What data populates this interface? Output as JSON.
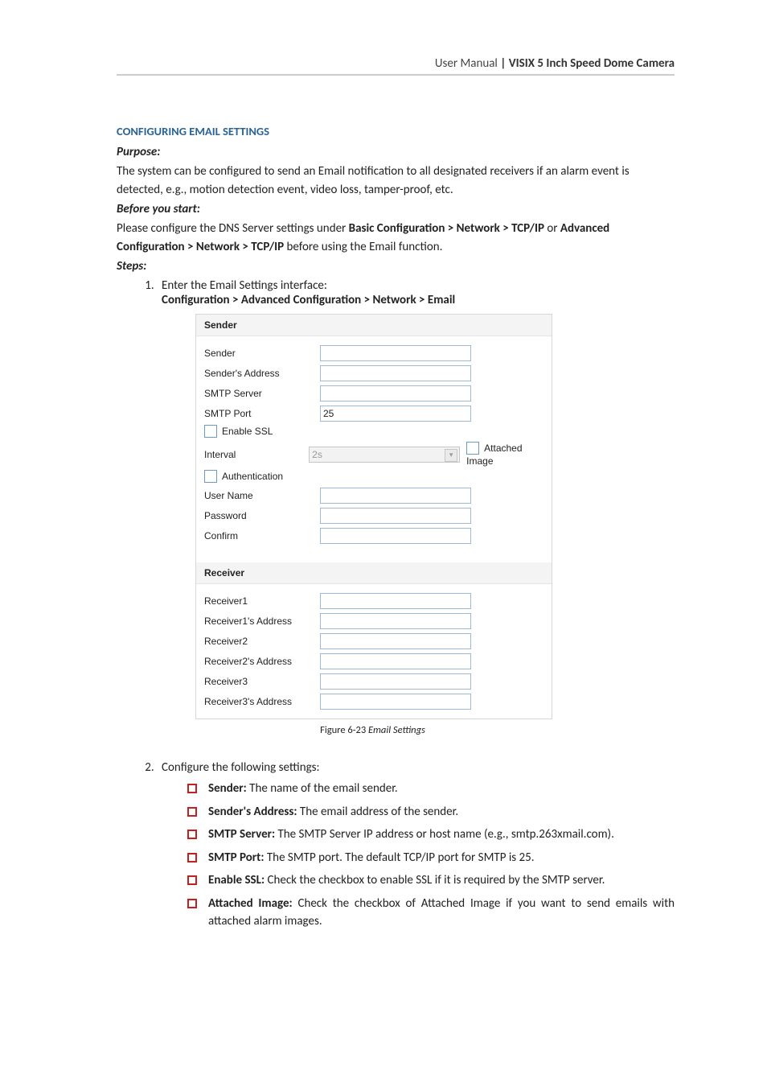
{
  "header": {
    "left": "User Manual",
    "right": " | VISIX 5 Inch Speed Dome Camera"
  },
  "section_title": "CONFIGURING EMAIL SETTINGS",
  "purpose_label": "Purpose:",
  "purpose_text": "The system can be configured to send an Email notification to all designated receivers if an alarm event is detected, e.g., motion detection event, video loss, tamper-proof, etc.",
  "before_label": "Before you start:",
  "before_text_a": "Please configure the DNS Server settings under ",
  "before_text_b": "Basic Configuration > Network > TCP/IP",
  "before_text_c": " or ",
  "before_text_d": "Advanced Configuration > Network > TCP/IP",
  "before_text_e": " before using the Email function.",
  "steps_label": "Steps:",
  "step1_a": "Enter the Email Settings interface:",
  "step1_b": "Configuration > Advanced Configuration > Network > Email",
  "ui": {
    "sender_header": "Sender",
    "sender": {
      "label": "Sender"
    },
    "senders_address": {
      "label": "Sender's Address"
    },
    "smtp_server": {
      "label": "SMTP Server"
    },
    "smtp_port": {
      "label": "SMTP Port",
      "value": "25"
    },
    "enable_ssl": {
      "label": "Enable SSL"
    },
    "interval": {
      "label": "Interval",
      "value": "2s"
    },
    "attached_image": {
      "label": "Attached Image"
    },
    "authentication": {
      "label": "Authentication"
    },
    "user_name": {
      "label": "User Name"
    },
    "password": {
      "label": "Password"
    },
    "confirm": {
      "label": "Confirm"
    },
    "receiver_header": "Receiver",
    "r1": {
      "label": "Receiver1"
    },
    "r1a": {
      "label": "Receiver1's Address"
    },
    "r2": {
      "label": "Receiver2"
    },
    "r2a": {
      "label": "Receiver2's Address"
    },
    "r3": {
      "label": "Receiver3"
    },
    "r3a": {
      "label": "Receiver3's Address"
    }
  },
  "figure": {
    "num": "Figure 6-23",
    "title": " Email Settings"
  },
  "step2": "Configure the following settings:",
  "bullets": {
    "b1a": "Sender:",
    "b1b": " The name of the email sender.",
    "b2a": "Sender's Address:",
    "b2b": " The email address of the sender.",
    "b3a": "SMTP Server:",
    "b3b": " The SMTP Server IP address or host name (e.g., smtp.263xmail.com).",
    "b4a": "SMTP Port:",
    "b4b": " The SMTP port. The default TCP/IP port for SMTP is 25.",
    "b5a": "Enable SSL:",
    "b5b": " Check the checkbox to enable SSL if it is required by the SMTP server.",
    "b6a": "Attached Image:",
    "b6b": " Check the checkbox of Attached Image if you want to send emails with attached alarm images."
  }
}
